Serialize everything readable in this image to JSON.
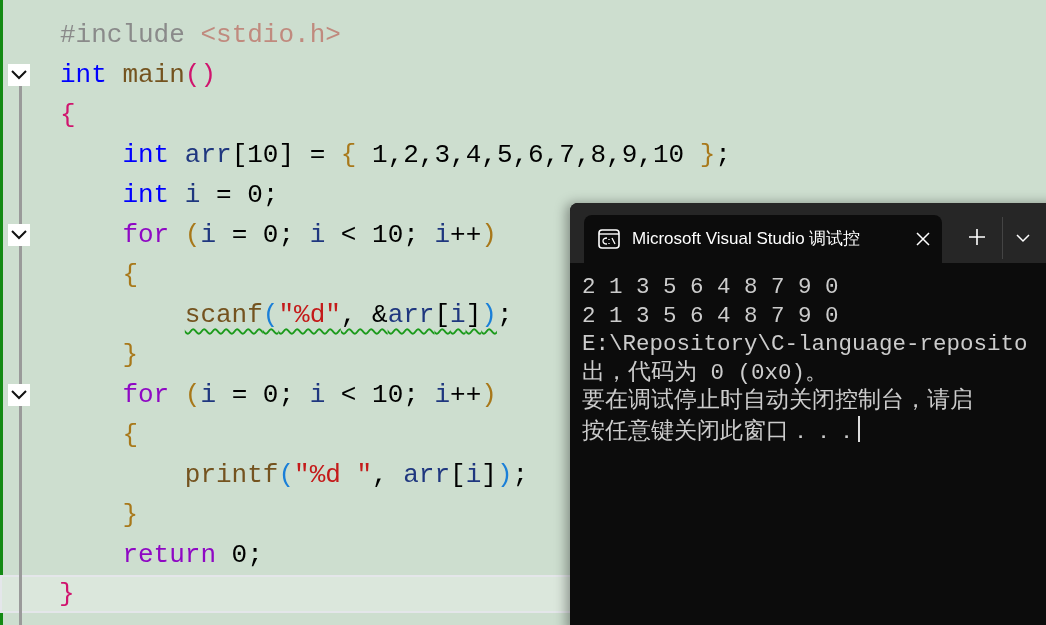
{
  "editor": {
    "lines": [
      {
        "tokens": [
          {
            "text": "#include ",
            "kind": "preproc"
          },
          {
            "text": "<stdio.h>",
            "kind": "path"
          }
        ]
      },
      {
        "fold": true,
        "tokens": [
          {
            "text": "int",
            "kind": "type"
          },
          {
            "text": " main",
            "kind": "func"
          },
          {
            "text": "()",
            "kind": "paren1"
          }
        ]
      },
      {
        "tokens": [
          {
            "text": "{",
            "kind": "paren1"
          }
        ],
        "children": [
          {
            "tokens": [
              {
                "text": "int",
                "kind": "type"
              },
              {
                "text": " arr",
                "kind": "var"
              },
              {
                "text": "[10] = ",
                "kind": "plain"
              },
              {
                "text": "{",
                "kind": "paren2"
              },
              {
                "text": " 1,2,3,4,5,6,7,8,9,10 ",
                "kind": "plain"
              },
              {
                "text": "}",
                "kind": "paren2"
              },
              {
                "text": ";",
                "kind": "plain"
              }
            ]
          },
          {
            "tokens": [
              {
                "text": "int",
                "kind": "type"
              },
              {
                "text": " i",
                "kind": "var"
              },
              {
                "text": " = 0;",
                "kind": "plain"
              }
            ]
          },
          {
            "fold": true,
            "tokens": [
              {
                "text": "for",
                "kind": "control"
              },
              {
                "text": " (",
                "kind": "paren2"
              },
              {
                "text": "i",
                "kind": "var"
              },
              {
                "text": " = 0; ",
                "kind": "plain"
              },
              {
                "text": "i",
                "kind": "var"
              },
              {
                "text": " < 10; ",
                "kind": "plain"
              },
              {
                "text": "i",
                "kind": "var"
              },
              {
                "text": "++",
                "kind": "plain"
              },
              {
                "text": ")",
                "kind": "paren2"
              }
            ]
          },
          {
            "tokens": [
              {
                "text": "{",
                "kind": "paren2"
              }
            ],
            "children": [
              {
                "tokens": [
                  {
                    "text": "scanf",
                    "kind": "func",
                    "warning": true
                  },
                  {
                    "text": "(",
                    "kind": "paren3",
                    "warning": true
                  },
                  {
                    "text": "\"%d\"",
                    "kind": "str",
                    "warning": true
                  },
                  {
                    "text": ", &",
                    "kind": "plain",
                    "warning": true
                  },
                  {
                    "text": "arr",
                    "kind": "var",
                    "warning": true
                  },
                  {
                    "text": "[",
                    "kind": "plain",
                    "warning": true
                  },
                  {
                    "text": "i",
                    "kind": "var",
                    "warning": true
                  },
                  {
                    "text": "]",
                    "kind": "plain",
                    "warning": true
                  },
                  {
                    "text": ")",
                    "kind": "paren3",
                    "warning": true
                  },
                  {
                    "text": ";",
                    "kind": "plain"
                  }
                ]
              }
            ]
          },
          {
            "tokens": [
              {
                "text": "}",
                "kind": "paren2"
              }
            ]
          },
          {
            "fold": true,
            "tokens": [
              {
                "text": "for",
                "kind": "control"
              },
              {
                "text": " (",
                "kind": "paren2"
              },
              {
                "text": "i",
                "kind": "var"
              },
              {
                "text": " = 0; ",
                "kind": "plain"
              },
              {
                "text": "i",
                "kind": "var"
              },
              {
                "text": " < 10; ",
                "kind": "plain"
              },
              {
                "text": "i",
                "kind": "var"
              },
              {
                "text": "++",
                "kind": "plain"
              },
              {
                "text": ")",
                "kind": "paren2"
              }
            ]
          },
          {
            "tokens": [
              {
                "text": "{",
                "kind": "paren2"
              }
            ],
            "children": [
              {
                "tokens": [
                  {
                    "text": "printf",
                    "kind": "func"
                  },
                  {
                    "text": "(",
                    "kind": "paren3"
                  },
                  {
                    "text": "\"%d \"",
                    "kind": "str"
                  },
                  {
                    "text": ", ",
                    "kind": "plain"
                  },
                  {
                    "text": "arr",
                    "kind": "var"
                  },
                  {
                    "text": "[",
                    "kind": "plain"
                  },
                  {
                    "text": "i",
                    "kind": "var"
                  },
                  {
                    "text": "]",
                    "kind": "plain"
                  },
                  {
                    "text": ")",
                    "kind": "paren3"
                  },
                  {
                    "text": ";",
                    "kind": "plain"
                  }
                ]
              }
            ]
          },
          {
            "tokens": [
              {
                "text": "}",
                "kind": "paren2"
              }
            ]
          },
          {
            "tokens": [
              {
                "text": "return",
                "kind": "control"
              },
              {
                "text": " 0;",
                "kind": "plain"
              }
            ]
          }
        ]
      },
      {
        "current": true,
        "tokens": [
          {
            "text": "}",
            "kind": "paren1"
          }
        ]
      }
    ]
  },
  "console": {
    "tab_title": "Microsoft Visual Studio 调试控",
    "output": [
      "2 1 3 5 6 4 8 7 9 0",
      "2 1 3 5 6 4 8 7 9 0",
      "E:\\Repository\\C-language-reposito",
      "出，代码为 0 (0x0)。",
      "要在调试停止时自动关闭控制台，请启",
      "按任意键关闭此窗口．．．"
    ]
  }
}
